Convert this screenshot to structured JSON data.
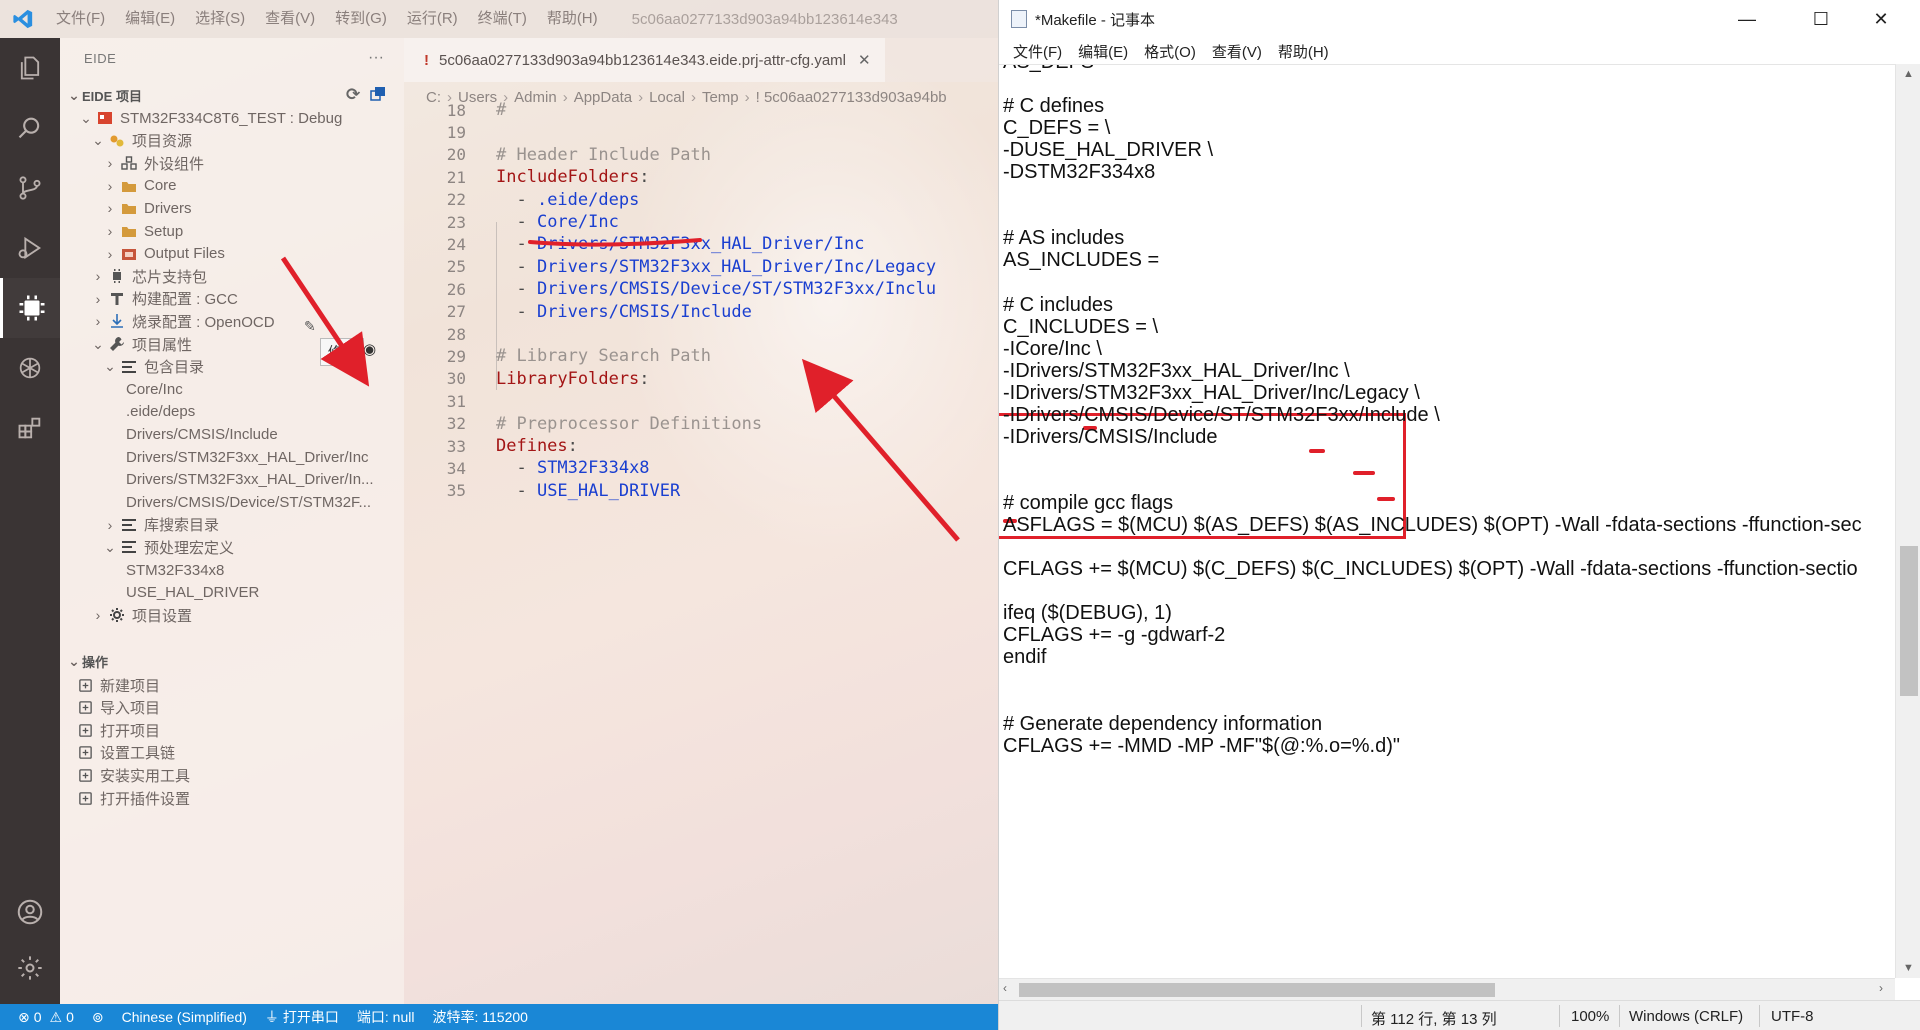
{
  "vscode": {
    "menu": [
      "文件(F)",
      "编辑(E)",
      "选择(S)",
      "查看(V)",
      "转到(G)",
      "运行(R)",
      "终端(T)",
      "帮助(H)"
    ],
    "window_title": "5c06aa0277133d903a94bb123614e343",
    "sidebar": {
      "header": "EIDE",
      "more": "···",
      "section": "EIDE 项目",
      "tree": [
        {
          "label": "STM32F334C8T6_TEST : Debug",
          "indent": 1,
          "chev": "⌄",
          "icon": "project-icon"
        },
        {
          "label": "项目资源",
          "indent": 2,
          "chev": "⌄",
          "icon": "resources-icon"
        },
        {
          "label": "外设组件",
          "indent": 3,
          "chev": "›",
          "icon": "components-icon"
        },
        {
          "label": "Core",
          "indent": 3,
          "chev": "›",
          "icon": "folder-icon"
        },
        {
          "label": "Drivers",
          "indent": 3,
          "chev": "›",
          "icon": "folder-icon"
        },
        {
          "label": "Setup",
          "indent": 3,
          "chev": "›",
          "icon": "folder-icon"
        },
        {
          "label": "Output Files",
          "indent": 3,
          "chev": "›",
          "icon": "output-icon"
        },
        {
          "label": "芯片支持包",
          "indent": 2,
          "chev": "›",
          "icon": "chip-icon"
        },
        {
          "label": "构建配置 : GCC",
          "indent": 2,
          "chev": "›",
          "icon": "build-icon"
        },
        {
          "label": "烧录配置 : OpenOCD",
          "indent": 2,
          "chev": "›",
          "icon": "flash-icon"
        },
        {
          "label": "项目属性",
          "indent": 2,
          "chev": "⌄",
          "icon": "wrench-icon"
        },
        {
          "label": "包含目录",
          "indent": 3,
          "chev": "⌄",
          "icon": "list-icon"
        },
        {
          "label": "Core/Inc",
          "indent": 5,
          "chev": "",
          "icon": ""
        },
        {
          "label": ".eide/deps",
          "indent": 5,
          "chev": "",
          "icon": ""
        },
        {
          "label": "Drivers/CMSIS/Include",
          "indent": 5,
          "chev": "",
          "icon": ""
        },
        {
          "label": "Drivers/STM32F3xx_HAL_Driver/Inc",
          "indent": 5,
          "chev": "",
          "icon": ""
        },
        {
          "label": "Drivers/STM32F3xx_HAL_Driver/In...",
          "indent": 5,
          "chev": "",
          "icon": ""
        },
        {
          "label": "Drivers/CMSIS/Device/ST/STM32F...",
          "indent": 5,
          "chev": "",
          "icon": ""
        },
        {
          "label": "库搜索目录",
          "indent": 3,
          "chev": "›",
          "icon": "list-icon"
        },
        {
          "label": "预处理宏定义",
          "indent": 3,
          "chev": "⌄",
          "icon": "list-icon"
        },
        {
          "label": "STM32F334x8",
          "indent": 5,
          "chev": "",
          "icon": ""
        },
        {
          "label": "USE_HAL_DRIVER",
          "indent": 5,
          "chev": "",
          "icon": ""
        },
        {
          "label": "项目设置",
          "indent": 2,
          "chev": "›",
          "icon": "gear-icon"
        }
      ],
      "tooltip": "修改",
      "ops_section": "操作",
      "ops": [
        "新建项目",
        "导入项目",
        "打开项目",
        "设置工具链",
        "安装实用工具",
        "打开插件设置"
      ]
    },
    "editor": {
      "tab": "5c06aa0277133d903a94bb123614e343.eide.prj-attr-cfg.yaml",
      "tab_close": "✕",
      "breadcrumbs": [
        "C:",
        "Users",
        "Admin",
        "AppData",
        "Local",
        "Temp",
        "!  5c06aa0277133d903a94bb"
      ],
      "lines": [
        {
          "n": "18",
          "segs": [
            {
              "c": "c-com",
              "t": "#"
            }
          ]
        },
        {
          "n": "19",
          "segs": []
        },
        {
          "n": "20",
          "segs": [
            {
              "c": "c-com",
              "t": "# Header Include Path"
            }
          ]
        },
        {
          "n": "21",
          "segs": [
            {
              "c": "c-key",
              "t": "IncludeFolders"
            },
            {
              "c": "c-dash",
              "t": ":"
            }
          ]
        },
        {
          "n": "22",
          "segs": [
            {
              "c": "c-dash",
              "t": "  - "
            },
            {
              "c": "c-str",
              "t": ".eide/deps"
            }
          ]
        },
        {
          "n": "23",
          "segs": [
            {
              "c": "c-dash",
              "t": "  - "
            },
            {
              "c": "c-str",
              "t": "Core/Inc"
            }
          ]
        },
        {
          "n": "24",
          "segs": [
            {
              "c": "c-dash",
              "t": "  - "
            },
            {
              "c": "c-str",
              "t": "Drivers/STM32F3xx_HAL_Driver/Inc"
            }
          ]
        },
        {
          "n": "25",
          "segs": [
            {
              "c": "c-dash",
              "t": "  - "
            },
            {
              "c": "c-str",
              "t": "Drivers/STM32F3xx_HAL_Driver/Inc/Legacy"
            }
          ]
        },
        {
          "n": "26",
          "segs": [
            {
              "c": "c-dash",
              "t": "  - "
            },
            {
              "c": "c-str",
              "t": "Drivers/CMSIS/Device/ST/STM32F3xx/Inclu"
            }
          ]
        },
        {
          "n": "27",
          "segs": [
            {
              "c": "c-dash",
              "t": "  - "
            },
            {
              "c": "c-str",
              "t": "Drivers/CMSIS/Include"
            }
          ]
        },
        {
          "n": "28",
          "segs": []
        },
        {
          "n": "29",
          "segs": [
            {
              "c": "c-com",
              "t": "# Library Search Path"
            }
          ]
        },
        {
          "n": "30",
          "segs": [
            {
              "c": "c-key",
              "t": "LibraryFolders"
            },
            {
              "c": "c-dash",
              "t": ":"
            }
          ]
        },
        {
          "n": "31",
          "segs": []
        },
        {
          "n": "32",
          "segs": [
            {
              "c": "c-com",
              "t": "# Preprocessor Definitions"
            }
          ]
        },
        {
          "n": "33",
          "segs": [
            {
              "c": "c-key",
              "t": "Defines"
            },
            {
              "c": "c-dash",
              "t": ":"
            }
          ]
        },
        {
          "n": "34",
          "segs": [
            {
              "c": "c-dash",
              "t": "  - "
            },
            {
              "c": "c-str",
              "t": "STM32F334x8"
            }
          ]
        },
        {
          "n": "35",
          "segs": [
            {
              "c": "c-dash",
              "t": "  - "
            },
            {
              "c": "c-str",
              "t": "USE_HAL_DRIVER"
            }
          ]
        }
      ]
    },
    "status": {
      "errors": "0",
      "warnings": "0",
      "language": "Chinese (Simplified)",
      "serial": "打开串口",
      "port": "端口: null",
      "baud": "波特率: 115200"
    }
  },
  "notepad": {
    "title": "*Makefile - 记事本",
    "minimize": "—",
    "maximize": "☐",
    "close": "✕",
    "menu": [
      "文件(F)",
      "编辑(E)",
      "格式(O)",
      "查看(V)",
      "帮助(H)"
    ],
    "lines": [
      "AS_DEFS =",
      "",
      "# C defines",
      "C_DEFS =  \\",
      "-DUSE_HAL_DRIVER \\",
      "-DSTM32F334x8",
      "",
      "",
      "# AS includes",
      "AS_INCLUDES =",
      "",
      "# C includes",
      "C_INCLUDES =  \\",
      "-ICore/Inc \\",
      "-IDrivers/STM32F3xx_HAL_Driver/Inc \\",
      "-IDrivers/STM32F3xx_HAL_Driver/Inc/Legacy \\",
      "-IDrivers/CMSIS/Device/ST/STM32F3xx/Include \\",
      "-IDrivers/CMSIS/Include",
      "",
      "",
      "# compile gcc flags",
      "ASFLAGS = $(MCU) $(AS_DEFS) $(AS_INCLUDES) $(OPT) -Wall -fdata-sections -ffunction-sec",
      "",
      "CFLAGS += $(MCU) $(C_DEFS) $(C_INCLUDES) $(OPT) -Wall -fdata-sections -ffunction-sectio",
      "",
      "ifeq ($(DEBUG), 1)",
      "CFLAGS += -g -gdwarf-2",
      "endif",
      "",
      "",
      "# Generate dependency information",
      "CFLAGS += -MMD -MP -MF\"$(@:%.o=%.d)\""
    ],
    "status": {
      "position": "第 112 行, 第 13 列",
      "zoom": "100%",
      "eol": "Windows (CRLF)",
      "encoding": "UTF-8"
    }
  }
}
